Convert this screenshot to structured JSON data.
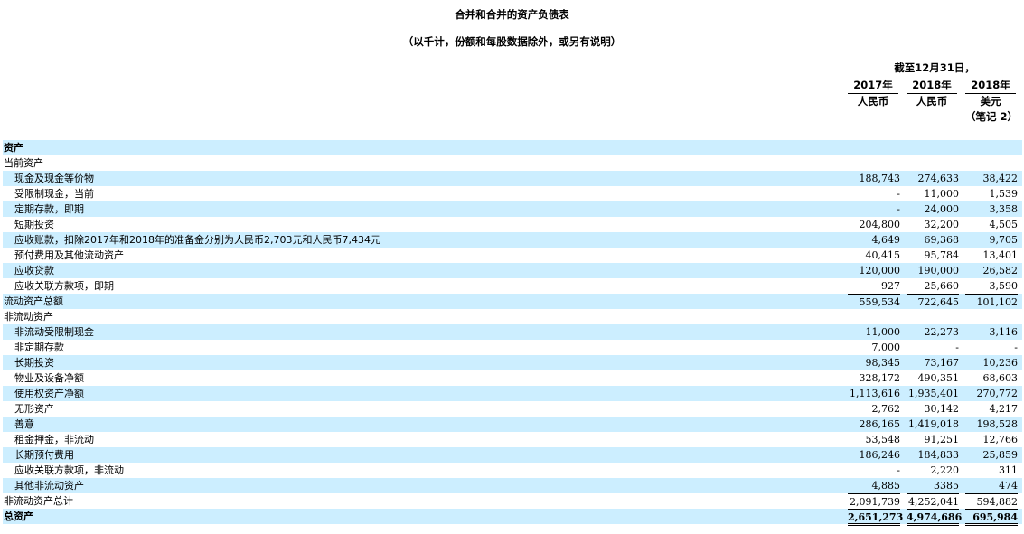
{
  "title": "合并和合并的资产负债表",
  "subtitle": "（以千计，份额和每股数据除外，或另有说明）",
  "header": {
    "period": "截至12月31日，",
    "columns": [
      {
        "year": "2017年",
        "currency": "人民币",
        "note": ""
      },
      {
        "year": "2018年",
        "currency": "人民币",
        "note": ""
      },
      {
        "year": "2018年",
        "currency": "美元",
        "note": "（笔记 2）"
      }
    ]
  },
  "rows": [
    {
      "label": "资产",
      "values": [
        "",
        "",
        ""
      ],
      "level": 0,
      "style": "bold",
      "band": true
    },
    {
      "label": "当前资产",
      "values": [
        "",
        "",
        ""
      ],
      "level": 0,
      "style": "",
      "band": false
    },
    {
      "label": "现金及现金等价物",
      "values": [
        "188,743",
        "274,633",
        "38,422"
      ],
      "level": 1,
      "style": "",
      "band": true
    },
    {
      "label": "受限制现金，当前",
      "values": [
        "-",
        "11,000",
        "1,539"
      ],
      "level": 1,
      "style": "",
      "band": false
    },
    {
      "label": "定期存款，即期",
      "values": [
        "-",
        "24,000",
        "3,358"
      ],
      "level": 1,
      "style": "",
      "band": true
    },
    {
      "label": "短期投资",
      "values": [
        "204,800",
        "32,200",
        "4,505"
      ],
      "level": 1,
      "style": "",
      "band": false
    },
    {
      "label": "应收账款，扣除2017年和2018年的准备金分别为人民币2,703元和人民币7,434元",
      "values": [
        "4,649",
        "69,368",
        "9,705"
      ],
      "level": 1,
      "style": "",
      "band": true
    },
    {
      "label": "预付费用及其他流动资产",
      "values": [
        "40,415",
        "95,784",
        "13,401"
      ],
      "level": 1,
      "style": "",
      "band": false
    },
    {
      "label": "应收贷款",
      "values": [
        "120,000",
        "190,000",
        "26,582"
      ],
      "level": 1,
      "style": "",
      "band": true
    },
    {
      "label": "应收关联方款项，即期",
      "values": [
        "927",
        "25,660",
        "3,590"
      ],
      "level": 1,
      "style": "",
      "band": false
    },
    {
      "label": "流动资产总额",
      "values": [
        "559,534",
        "722,645",
        "101,102"
      ],
      "level": 0,
      "style": "subtotal",
      "band": true
    },
    {
      "label": "非流动资产",
      "values": [
        "",
        "",
        ""
      ],
      "level": 0,
      "style": "",
      "band": false
    },
    {
      "label": "非流动受限制现金",
      "values": [
        "11,000",
        "22,273",
        "3,116"
      ],
      "level": 1,
      "style": "",
      "band": true
    },
    {
      "label": "非定期存款",
      "values": [
        "7,000",
        "-",
        "-"
      ],
      "level": 1,
      "style": "",
      "band": false
    },
    {
      "label": "长期投资",
      "values": [
        "98,345",
        "73,167",
        "10,236"
      ],
      "level": 1,
      "style": "",
      "band": true
    },
    {
      "label": "物业及设备净额",
      "values": [
        "328,172",
        "490,351",
        "68,603"
      ],
      "level": 1,
      "style": "",
      "band": false
    },
    {
      "label": "使用权资产净额",
      "values": [
        "1,113,616",
        "1,935,401",
        "270,772"
      ],
      "level": 1,
      "style": "",
      "band": true
    },
    {
      "label": "无形资产",
      "values": [
        "2,762",
        "30,142",
        "4,217"
      ],
      "level": 1,
      "style": "",
      "band": false
    },
    {
      "label": "善意",
      "values": [
        "286,165",
        "1,419,018",
        "198,528"
      ],
      "level": 1,
      "style": "",
      "band": true
    },
    {
      "label": "租金押金，非流动",
      "values": [
        "53,548",
        "91,251",
        "12,766"
      ],
      "level": 1,
      "style": "",
      "band": false
    },
    {
      "label": "长期预付费用",
      "values": [
        "186,246",
        "184,833",
        "25,859"
      ],
      "level": 1,
      "style": "",
      "band": true
    },
    {
      "label": "应收关联方款项，非流动",
      "values": [
        "-",
        "2,220",
        "311"
      ],
      "level": 1,
      "style": "",
      "band": false
    },
    {
      "label": "其他非流动资产",
      "values": [
        "4,885",
        "3385",
        "474"
      ],
      "level": 1,
      "style": "",
      "band": true
    },
    {
      "label": "非流动资产总计",
      "values": [
        "2,091,739",
        "4,252,041",
        "594,882"
      ],
      "level": 0,
      "style": "subtotal",
      "band": false
    },
    {
      "label": "总资产",
      "values": [
        "2,651,273",
        "4,974,686",
        "695,984"
      ],
      "level": 0,
      "style": "bold total",
      "band": true
    }
  ]
}
